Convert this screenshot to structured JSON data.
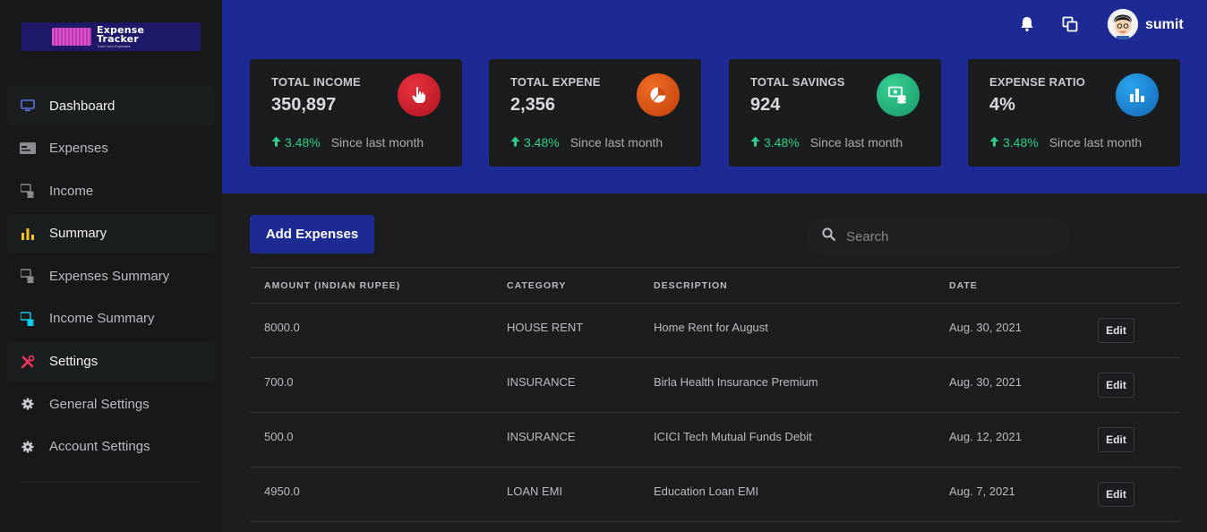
{
  "brand": {
    "title_line1": "Expense",
    "title_line2": "Tracker",
    "tagline": "Track Your Expenses"
  },
  "sidebar": {
    "items": [
      {
        "label": "Dashboard",
        "icon": "monitor-icon",
        "color": "#5e72e4"
      },
      {
        "label": "Expenses",
        "icon": "card-icon",
        "color": "#8a8d93"
      },
      {
        "label": "Income",
        "icon": "coins-icon",
        "color": "#8a8d93"
      },
      {
        "label": "Summary",
        "icon": "bar-chart-icon",
        "color": "#f5c518"
      },
      {
        "label": "Expenses Summary",
        "icon": "coins-icon",
        "color": "#8a8d93"
      },
      {
        "label": "Income Summary",
        "icon": "coins-icon",
        "color": "#11cdef"
      },
      {
        "label": "Settings",
        "icon": "tools-icon",
        "color": "#f5365c"
      },
      {
        "label": "General Settings",
        "icon": "gear-icon",
        "color": "#c9ccd2"
      },
      {
        "label": "Account Settings",
        "icon": "gear-icon",
        "color": "#c9ccd2"
      }
    ]
  },
  "topbar": {
    "username": "sumit"
  },
  "stats": [
    {
      "label": "TOTAL INCOME",
      "value": "350,897",
      "change": "3.48%",
      "since": "Since last month",
      "icon": "pointer-hand-icon",
      "color": "#d0202e"
    },
    {
      "label": "TOTAL EXPENE",
      "value": "2,356",
      "change": "3.48%",
      "since": "Since last month",
      "icon": "pie-chart-icon",
      "color": "#e05a15"
    },
    {
      "label": "TOTAL SAVINGS",
      "value": "924",
      "change": "3.48%",
      "since": "Since last month",
      "icon": "money-coins-icon",
      "color": "#26b57e"
    },
    {
      "label": "EXPENSE RATIO",
      "value": "4%",
      "change": "3.48%",
      "since": "Since last month",
      "icon": "bar-chart-icon",
      "color": "#1a87d6"
    }
  ],
  "actions": {
    "add_label": "Add Expenses"
  },
  "search": {
    "placeholder": "Search"
  },
  "table": {
    "headers": [
      "AMOUNT (INDIAN RUPEE)",
      "CATEGORY",
      "DESCRIPTION",
      "DATE"
    ],
    "rows": [
      {
        "amount": "8000.0",
        "category": "HOUSE RENT",
        "description": "Home Rent for August",
        "date": "Aug. 30, 2021",
        "action": "Edit"
      },
      {
        "amount": "700.0",
        "category": "INSURANCE",
        "description": "Birla Health Insurance Premium",
        "date": "Aug. 30, 2021",
        "action": "Edit"
      },
      {
        "amount": "500.0",
        "category": "INSURANCE",
        "description": "ICICI Tech Mutual Funds Debit",
        "date": "Aug. 12, 2021",
        "action": "Edit"
      },
      {
        "amount": "4950.0",
        "category": "LOAN EMI",
        "description": "Education Loan EMI",
        "date": "Aug. 7, 2021",
        "action": "Edit"
      }
    ]
  }
}
